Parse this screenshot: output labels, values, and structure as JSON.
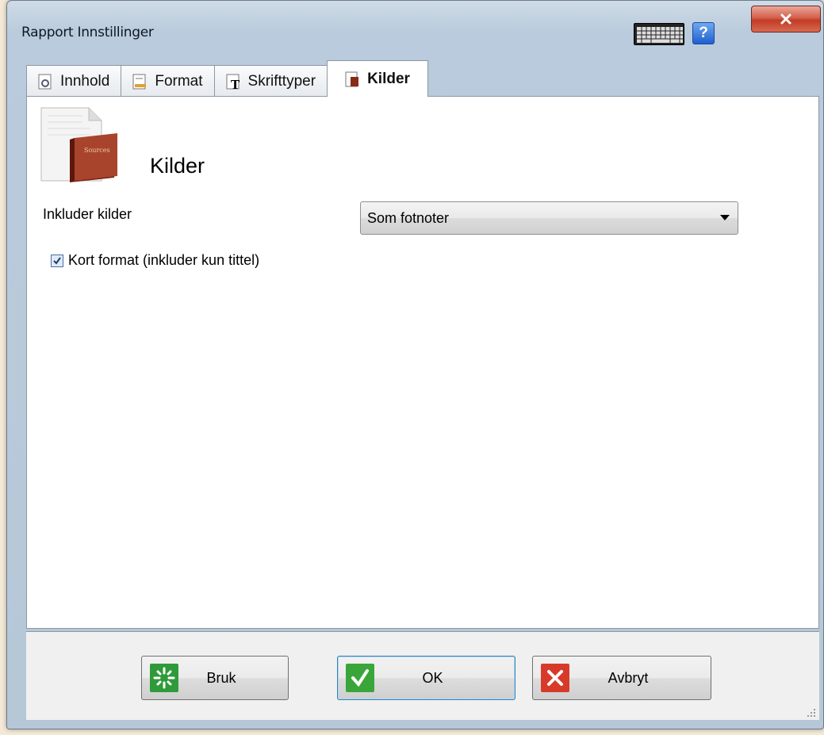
{
  "window": {
    "title": "Rapport Innstillinger",
    "close_label": "x",
    "help_label": "?"
  },
  "tabs": [
    {
      "label": "Innhold",
      "icon": "settings-doc-icon",
      "active": false
    },
    {
      "label": "Format",
      "icon": "format-doc-icon",
      "active": false
    },
    {
      "label": "Skrifttyper",
      "icon": "font-doc-icon",
      "active": false
    },
    {
      "label": "Kilder",
      "icon": "book-doc-icon",
      "active": true
    }
  ],
  "section": {
    "title": "Kilder",
    "icon": "sources-book-icon",
    "icon_book_text": "Sources"
  },
  "form": {
    "include_sources_label": "Inkluder kilder",
    "include_sources_value": "Som fotnoter",
    "short_format_label": "Kort format (inkluder kun tittel)",
    "short_format_checked": true
  },
  "buttons": {
    "apply_label": "Bruk",
    "ok_label": "OK",
    "cancel_label": "Avbryt"
  },
  "colors": {
    "ok_icon": "#3aa63a",
    "cancel_icon": "#d83a2a",
    "apply_icon": "#2f9a3a"
  }
}
